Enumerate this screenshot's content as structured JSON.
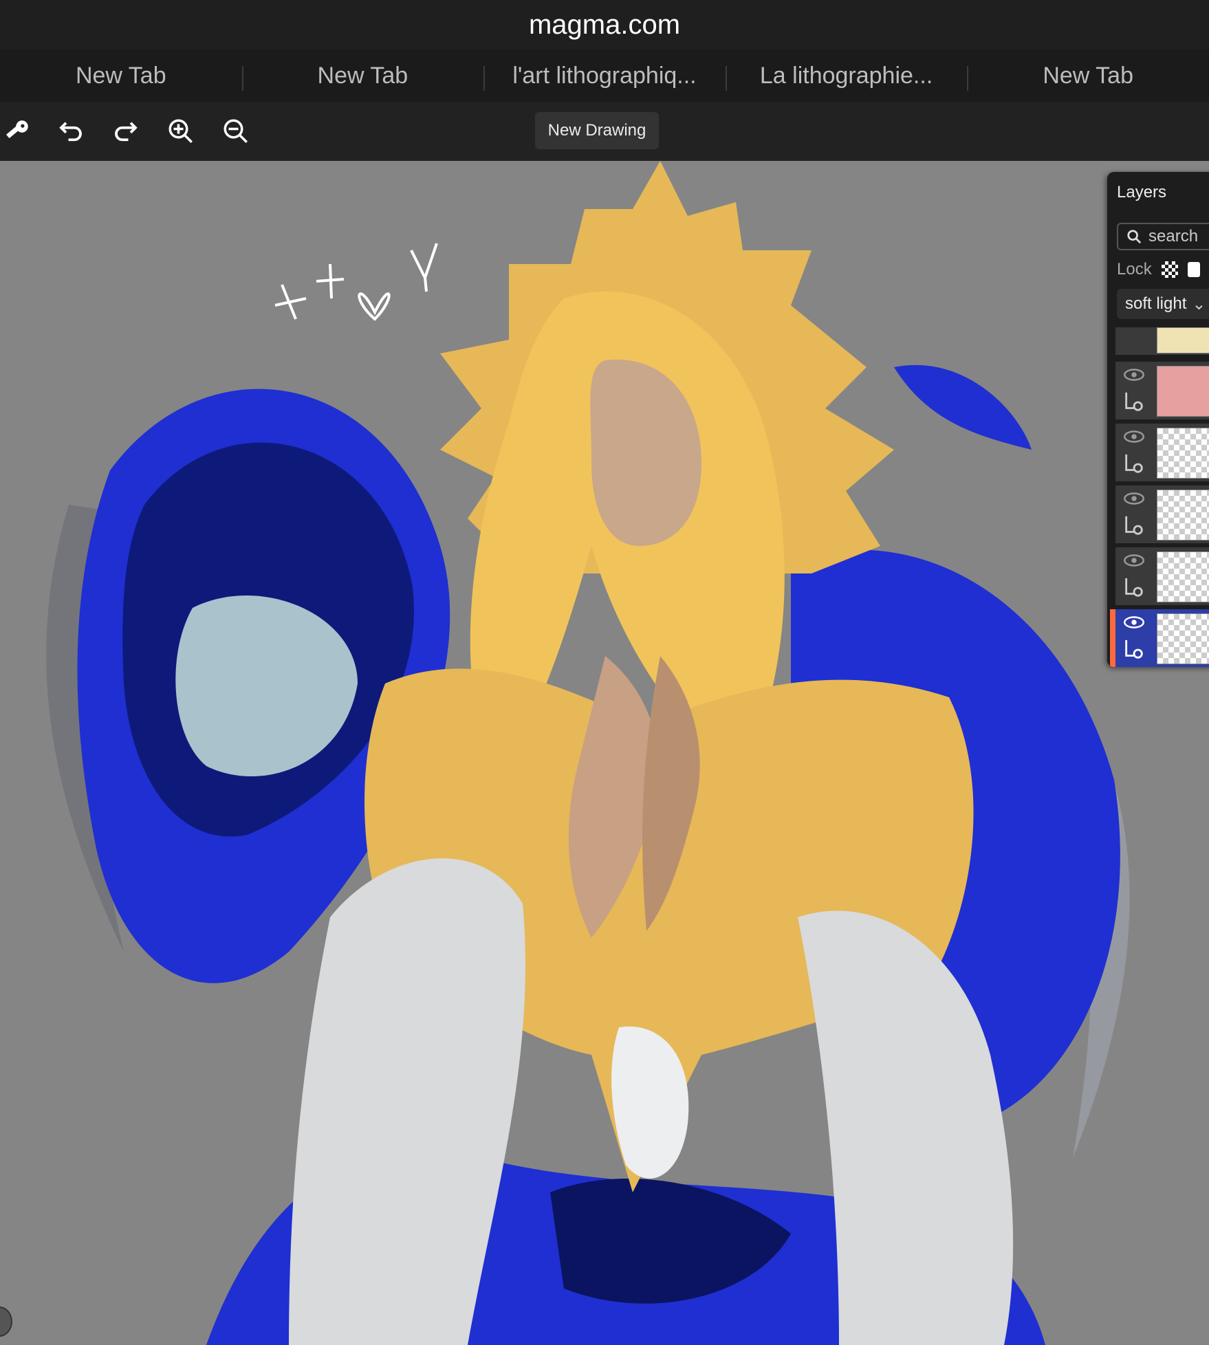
{
  "browser": {
    "url": "magma.com",
    "tabs": [
      "New Tab",
      "New Tab",
      "l'art lithographiq...",
      "La lithographie...",
      "New Tab"
    ]
  },
  "toolbar": {
    "tools": [
      "key-icon",
      "undo-icon",
      "redo-icon",
      "zoom-in-icon",
      "zoom-out-icon"
    ],
    "new_drawing_label": "New Drawing"
  },
  "layers_panel": {
    "title": "Layers",
    "search_placeholder": "search",
    "lock_label": "Lock",
    "blend_mode": "soft light",
    "active_color": "#ff6a3d"
  },
  "colors": {
    "canvas_bg": "#858585",
    "gold": "#e6b857",
    "blue": "#1f2fd1",
    "white_robe": "#d8dadc"
  }
}
